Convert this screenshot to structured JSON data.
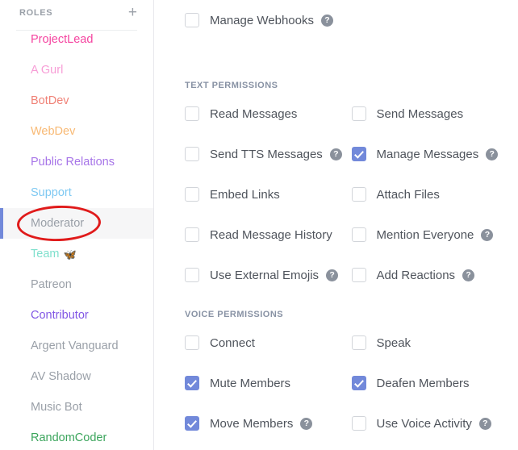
{
  "sidebar": {
    "header": {
      "title": "ROLES",
      "add_icon": "plus-icon",
      "add_label": "+"
    },
    "selected_role": "Moderator",
    "accent_color": "#7289da",
    "annotation": {
      "shape": "ellipse",
      "color": "#e01b1b",
      "targets": "Moderator"
    },
    "roles": [
      {
        "label": "ProjectLead",
        "color": "#f544a0",
        "emoji": "",
        "selected": false,
        "clipped": true
      },
      {
        "label": "A Gurl",
        "color": "#f79dd6",
        "emoji": "",
        "selected": false
      },
      {
        "label": "BotDev",
        "color": "#f08277",
        "emoji": "",
        "selected": false
      },
      {
        "label": "WebDev",
        "color": "#f8b974",
        "emoji": "",
        "selected": false
      },
      {
        "label": "Public Relations",
        "color": "#a775e8",
        "emoji": "",
        "selected": false
      },
      {
        "label": "Support",
        "color": "#7fc9f2",
        "emoji": "",
        "selected": false
      },
      {
        "label": "Moderator",
        "color": "#9aa0a8",
        "emoji": "",
        "selected": true
      },
      {
        "label": "Team",
        "color": "#7fe0cd",
        "emoji": "🦋",
        "selected": false
      },
      {
        "label": "Patreon",
        "color": "#9aa0a8",
        "emoji": "",
        "selected": false
      },
      {
        "label": "Contributor",
        "color": "#8257e5",
        "emoji": "",
        "selected": false
      },
      {
        "label": "Argent Vanguard",
        "color": "#9aa0a8",
        "emoji": "",
        "selected": false
      },
      {
        "label": "AV Shadow",
        "color": "#9aa0a8",
        "emoji": "",
        "selected": false
      },
      {
        "label": "Music Bot",
        "color": "#9aa0a8",
        "emoji": "",
        "selected": false
      },
      {
        "label": "RandomCoder",
        "color": "#3ba55c",
        "emoji": "",
        "selected": false
      }
    ]
  },
  "permissions": {
    "help_glyph": "?",
    "top_permission": {
      "label": "Manage Webhooks",
      "checked": false,
      "help": true
    },
    "sections": [
      {
        "title": "TEXT PERMISSIONS",
        "rows": [
          [
            {
              "label": "Read Messages",
              "checked": false,
              "help": false
            },
            {
              "label": "Send Messages",
              "checked": false,
              "help": false
            }
          ],
          [
            {
              "label": "Send TTS Messages",
              "checked": false,
              "help": true
            },
            {
              "label": "Manage Messages",
              "checked": true,
              "help": true
            }
          ],
          [
            {
              "label": "Embed Links",
              "checked": false,
              "help": false
            },
            {
              "label": "Attach Files",
              "checked": false,
              "help": false
            }
          ],
          [
            {
              "label": "Read Message History",
              "checked": false,
              "help": false
            },
            {
              "label": "Mention Everyone",
              "checked": false,
              "help": true
            }
          ],
          [
            {
              "label": "Use External Emojis",
              "checked": false,
              "help": true
            },
            {
              "label": "Add Reactions",
              "checked": false,
              "help": true
            }
          ]
        ]
      },
      {
        "title": "VOICE PERMISSIONS",
        "rows": [
          [
            {
              "label": "Connect",
              "checked": false,
              "help": false
            },
            {
              "label": "Speak",
              "checked": false,
              "help": false
            }
          ],
          [
            {
              "label": "Mute Members",
              "checked": true,
              "help": false
            },
            {
              "label": "Deafen Members",
              "checked": true,
              "help": false
            }
          ],
          [
            {
              "label": "Move Members",
              "checked": true,
              "help": true
            },
            {
              "label": "Use Voice Activity",
              "checked": false,
              "help": true
            }
          ]
        ]
      }
    ]
  }
}
